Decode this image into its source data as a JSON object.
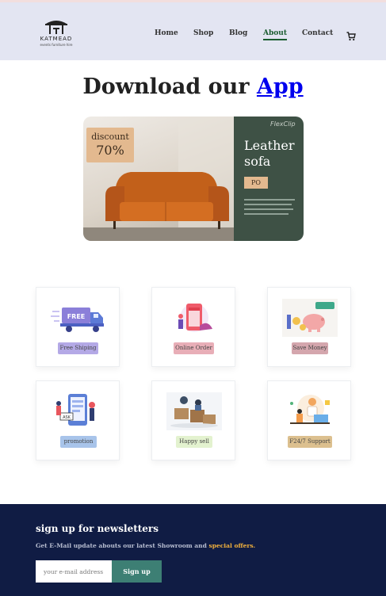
{
  "nav": {
    "logo": {
      "name": "KATMEAD",
      "tagline": "events furniture hire"
    },
    "items": [
      {
        "label": "Home"
      },
      {
        "label": "Shop"
      },
      {
        "label": "Blog"
      },
      {
        "label": "About",
        "active": true
      },
      {
        "label": "Contact"
      }
    ],
    "cart_icon": "cart-icon"
  },
  "hero": {
    "title_prefix": "Download our",
    "title_link": "App"
  },
  "banner": {
    "discount_label": "discount",
    "discount_value": "70%",
    "brand": "FlexClip",
    "heading_line1": "Leather",
    "heading_line2": "sofa",
    "badge": "PO"
  },
  "features": [
    {
      "label": "Free Shiping",
      "pill_color": "#b4a9e6",
      "icon": "free-shipping-truck"
    },
    {
      "label": "Online Order",
      "pill_color": "#e8aeb7",
      "icon": "online-order-shop"
    },
    {
      "label": "Save Money",
      "pill_color": "#d4a6ad",
      "icon": "save-money-piggy"
    },
    {
      "label": "promotion",
      "pill_color": "#a8c4ea",
      "icon": "promotion-phone"
    },
    {
      "label": "Happy sell",
      "pill_color": "#e3f2cf",
      "icon": "happy-sell-boxes"
    },
    {
      "label": "F24/7 Support",
      "pill_color": "#dcc08f",
      "icon": "support-agent"
    }
  ],
  "newsletter": {
    "title": "sign up for newsletters",
    "text": "Get E-Mail update abouts our latest Showroom and",
    "highlight": "special offers.",
    "email_placeholder": "your e-mail address",
    "button_label": "Sign up"
  },
  "colors": {
    "nav_bg": "#e3e5f2",
    "footer_bg": "#101c44",
    "accent_green": "#1a5c2f",
    "signup_button": "#3d7f74",
    "highlight": "#f2b13c",
    "link": "#0000ee"
  }
}
